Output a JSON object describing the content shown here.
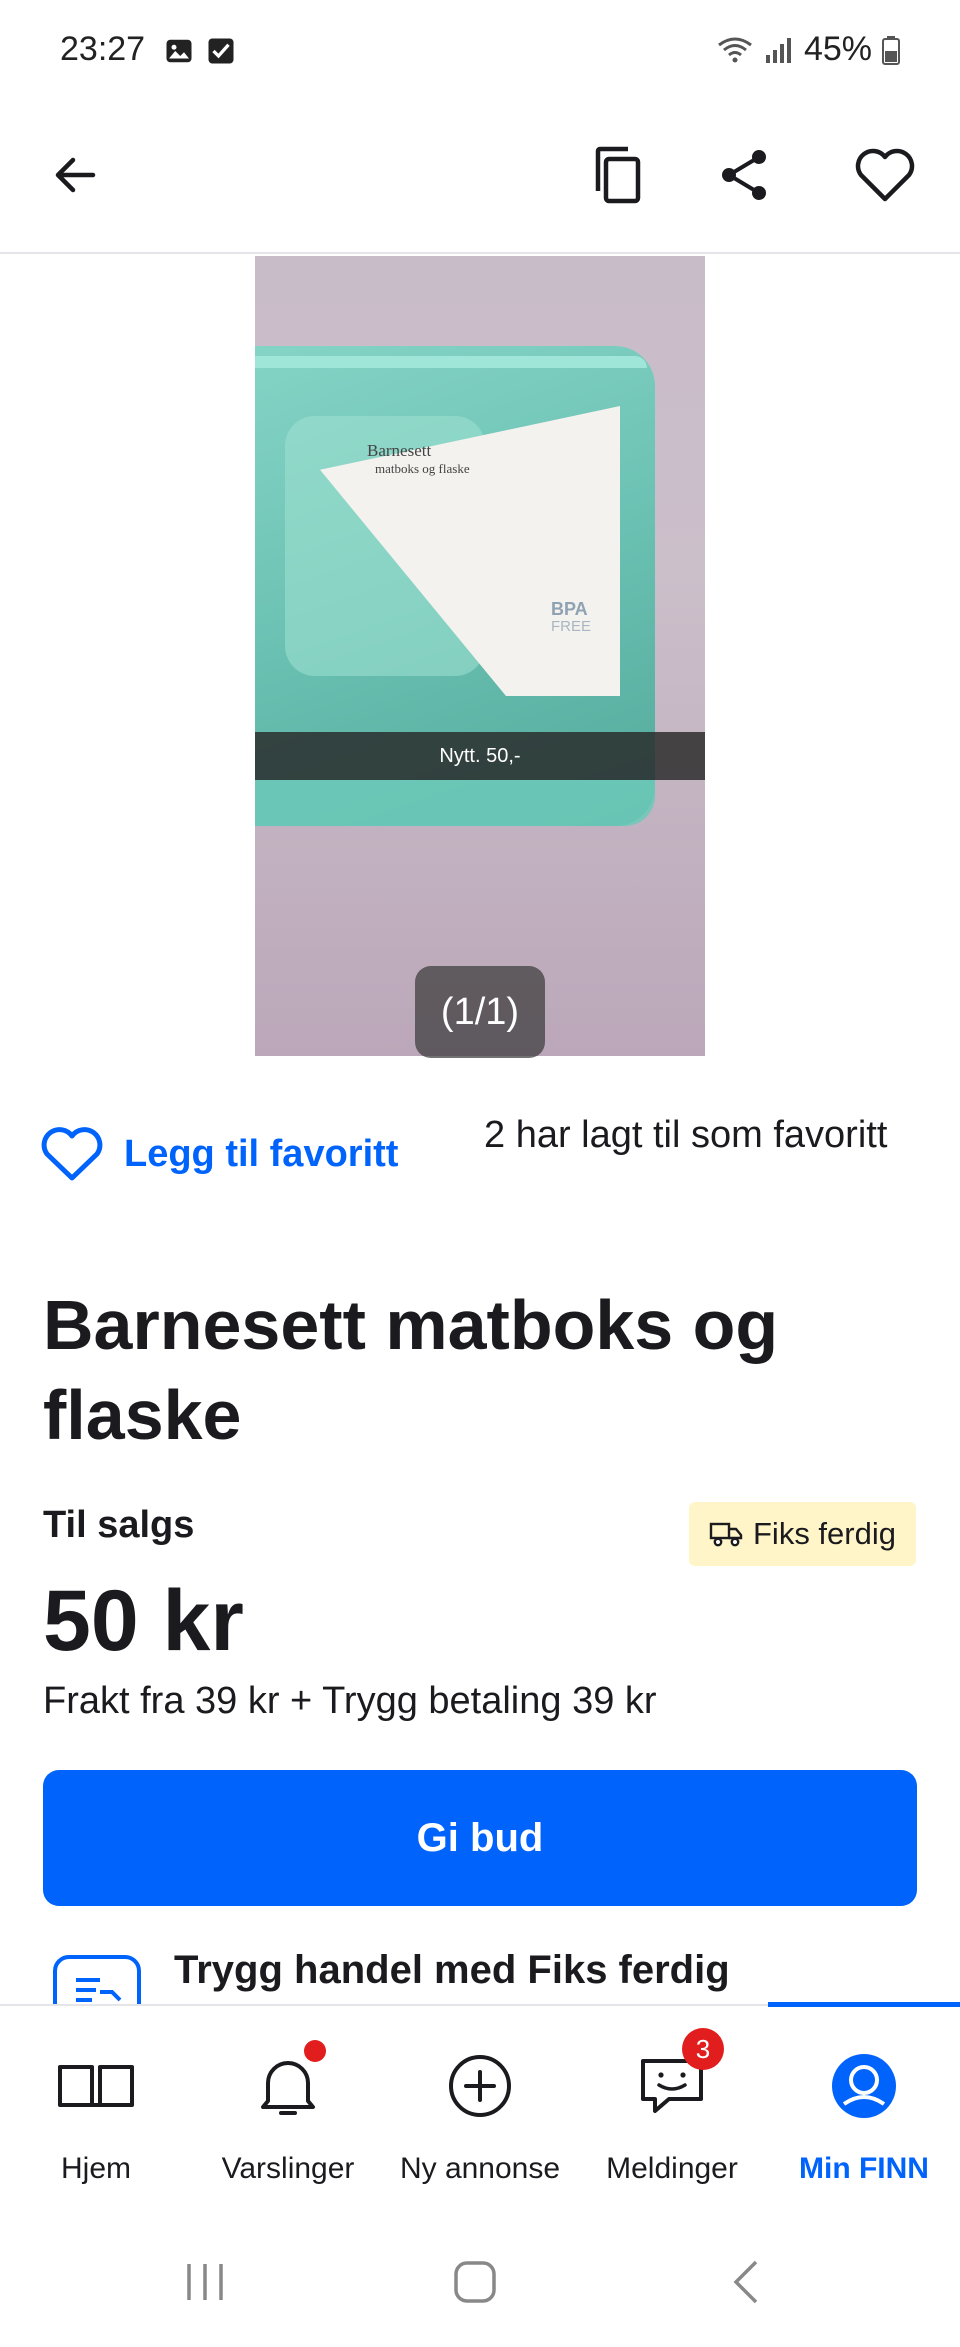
{
  "status_bar": {
    "time": "23:27",
    "battery": "45%",
    "icons": [
      "image-icon",
      "checkbox-icon",
      "wifi-icon",
      "signal-icon",
      "battery-icon"
    ]
  },
  "app_bar": {
    "actions": [
      "back-arrow-icon",
      "copy-icon",
      "share-icon",
      "heart-icon"
    ]
  },
  "gallery": {
    "photo_label_title": "Barnesett",
    "photo_label_subtitle": "matboks og flaske",
    "photo_label_bpa": "BPA",
    "photo_label_free": "FREE",
    "photo_price_tag": "Nytt. 50,-",
    "counter": "(1/1)"
  },
  "favorite": {
    "button_label": "Legg til favoritt",
    "count_text": "2 har lagt til som favoritt"
  },
  "listing": {
    "title": "Barnesett matboks og flaske",
    "status": "Til salgs",
    "badge": "Fiks ferdig",
    "price": "50 kr",
    "shipping": "Frakt fra 39 kr + Trygg betaling 39 kr",
    "bid_button": "Gi bud",
    "safe_trade": "Trygg handel med Fiks ferdig"
  },
  "bottom_nav": {
    "items": [
      {
        "label": "Hjem",
        "icon": "book-icon"
      },
      {
        "label": "Varslinger",
        "icon": "bell-icon"
      },
      {
        "label": "Ny annonse",
        "icon": "plus-circle-icon"
      },
      {
        "label": "Meldinger",
        "icon": "chat-icon",
        "badge": "3"
      },
      {
        "label": "Min FINN",
        "icon": "profile-icon"
      }
    ],
    "active": "Min FINN"
  },
  "colors": {
    "accent": "#0063fb",
    "badge_bg": "#fff5c8",
    "notification": "#e21d1d"
  }
}
